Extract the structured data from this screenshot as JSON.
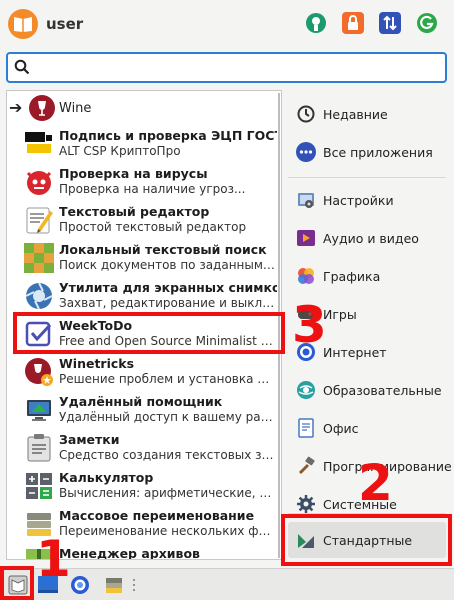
{
  "header": {
    "username": "user"
  },
  "search": {
    "value": ""
  },
  "wine": {
    "label": "Wine"
  },
  "apps": [
    {
      "title": "Подпись и проверка ЭЦП ГОСТ",
      "desc": "ALT CSP КриптоПро",
      "icon": "altcsp-icon"
    },
    {
      "title": "Проверка на вирусы",
      "desc": "Проверка на наличие угроз...",
      "icon": "antivirus-icon"
    },
    {
      "title": "Текстовый редактор",
      "desc": "Простой текстовый редактор",
      "icon": "text-editor-icon"
    },
    {
      "title": "Локальный текстовый поиск",
      "desc": "Поиск документов по заданным условиям",
      "icon": "text-search-icon"
    },
    {
      "title": "Утилита для экранных снимков",
      "desc": "Захват, редактирование и выкладывание",
      "icon": "screenshot-icon"
    },
    {
      "title": "WeekToDo",
      "desc": "Free and Open Source Minimalist Weekly Planner",
      "icon": "weektodo-icon"
    },
    {
      "title": "Winetricks",
      "desc": "Решение проблем и установка программ",
      "icon": "winetricks-icon"
    },
    {
      "title": "Удалённый помощник",
      "desc": "Удалённый доступ к вашему рабочему столу",
      "icon": "remote-assist-icon"
    },
    {
      "title": "Заметки",
      "desc": "Средство создания текстовых заметок",
      "icon": "notes-icon"
    },
    {
      "title": "Калькулятор",
      "desc": "Вычисления: арифметические, научные",
      "icon": "calculator-icon"
    },
    {
      "title": "Массовое переименование",
      "desc": "Переименование нескольких файлов",
      "icon": "bulk-rename-icon"
    },
    {
      "title": "Менеджер архивов",
      "desc": "",
      "icon": "archive-manager-icon"
    }
  ],
  "categories": {
    "recent": "Недавние",
    "all": "Все приложения",
    "settings": "Настройки",
    "audio_video": "Аудио и видео",
    "graphics": "Графика",
    "games": "Игры",
    "internet": "Интернет",
    "education": "Образовательные",
    "office": "Офис",
    "programming": "Программирование",
    "system": "Системные",
    "standard": "Стандартные"
  },
  "annotations": {
    "n1": "1",
    "n2": "2",
    "n3": "3"
  },
  "colors": {
    "accent": "#2d7dd2",
    "annotation": "#e11111"
  }
}
